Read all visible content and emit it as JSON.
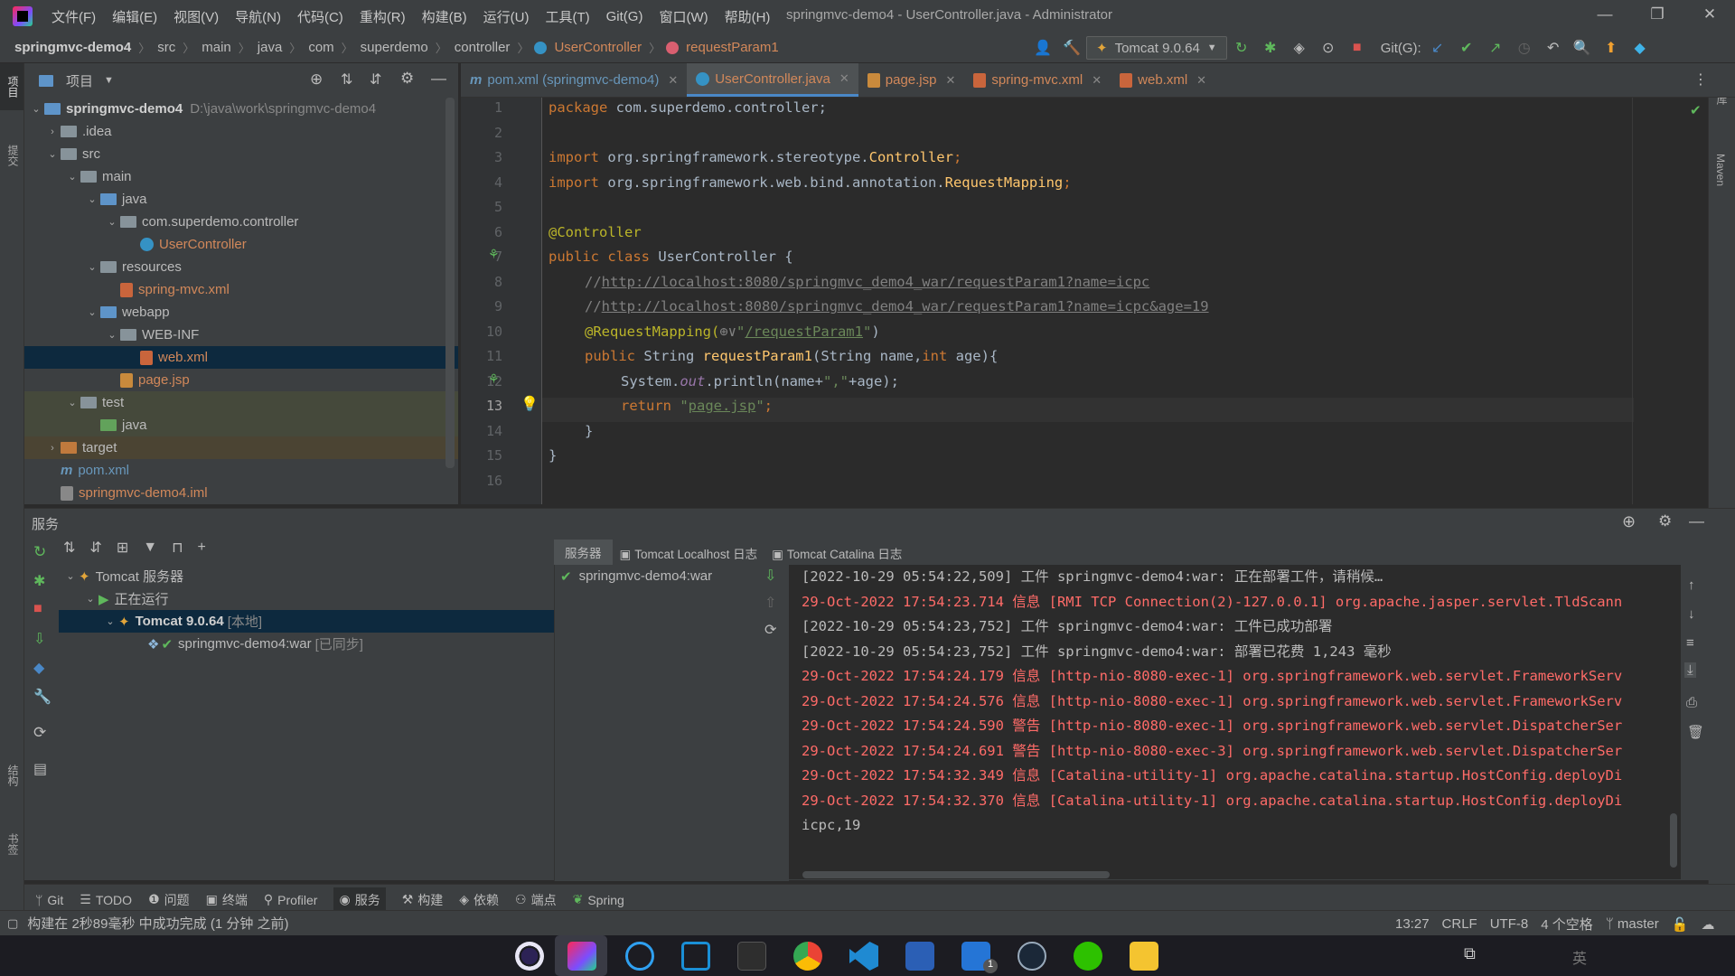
{
  "window": {
    "title": "springmvc-demo4 - UserController.java - Administrator",
    "menu": [
      "文件(F)",
      "编辑(E)",
      "视图(V)",
      "导航(N)",
      "代码(C)",
      "重构(R)",
      "构建(B)",
      "运行(U)",
      "工具(T)",
      "Git(G)",
      "窗口(W)",
      "帮助(H)"
    ]
  },
  "breadcrumb": [
    "springmvc-demo4",
    "src",
    "main",
    "java",
    "com",
    "superdemo",
    "controller",
    "UserController",
    "requestParam1"
  ],
  "toolbar": {
    "run_config": "Tomcat 9.0.64",
    "git_label": "Git(G):"
  },
  "left_strip": {
    "project_label": "项目",
    "commit_label": "提交",
    "structure_label": "结构",
    "bookmarks_label": "书签"
  },
  "right_strip": {
    "database_label": "数据库",
    "maven_label": "Maven",
    "notifications_label": "通知"
  },
  "project": {
    "header": "项目",
    "tree": [
      {
        "label": "springmvc-demo4",
        "extra": "D:\\java\\work\\springmvc-demo4"
      },
      {
        "label": ".idea"
      },
      {
        "label": "src"
      },
      {
        "label": "main"
      },
      {
        "label": "java"
      },
      {
        "label": "com.superdemo.controller"
      },
      {
        "label": "UserController"
      },
      {
        "label": "resources"
      },
      {
        "label": "spring-mvc.xml"
      },
      {
        "label": "webapp"
      },
      {
        "label": "WEB-INF"
      },
      {
        "label": "web.xml"
      },
      {
        "label": "page.jsp"
      },
      {
        "label": "test"
      },
      {
        "label": "java"
      },
      {
        "label": "target"
      },
      {
        "label": "pom.xml"
      },
      {
        "label": "springmvc-demo4.iml"
      }
    ]
  },
  "tabs": [
    {
      "label": "pom.xml (springmvc-demo4)"
    },
    {
      "label": "UserController.java"
    },
    {
      "label": "page.jsp"
    },
    {
      "label": "spring-mvc.xml"
    },
    {
      "label": "web.xml"
    }
  ],
  "editor": {
    "line_numbers": [
      "1",
      "2",
      "3",
      "4",
      "5",
      "6",
      "7",
      "8",
      "9",
      "10",
      "11",
      "12",
      "13",
      "14",
      "15",
      "16"
    ],
    "current_line": "13",
    "code": {
      "l1_kw": "package",
      "l1_rest": " com.superdemo.controller;",
      "l3_kw": "import",
      "l3_rest": " org.springframework.stereotype.",
      "l3_cls": "Controller",
      "l3_end": ";",
      "l4_kw": "import",
      "l4_rest": " org.springframework.web.bind.annotation.",
      "l4_cls": "RequestMapping",
      "l4_end": ";",
      "l6_ann": "@Controller",
      "l7_kw": "public class",
      "l7_rest": " UserController {",
      "l8_cmt": "//",
      "l8_url": "http://localhost:8080/springmvc_demo4_war/requestParam1?name=icpc",
      "l9_cmt": "//",
      "l9_url": "http://localhost:8080/springmvc_demo4_war/requestParam1?name=icpc&age=19",
      "l10_ann": "@RequestMapping(",
      "l10_icon": "⊕∨",
      "l10_q1": "\"",
      "l10_str": "/requestParam1",
      "l10_q2": "\"",
      "l10_end": ")",
      "l11_kw": "public",
      "l11_a": " String ",
      "l11_fn": "requestParam1",
      "l11_b": "(String name,",
      "l11_kw2": "int",
      "l11_c": " age){",
      "l12_a": "System.",
      "l12_fld": "out",
      "l12_b": ".println(name+",
      "l12_str": "\",\"",
      "l12_c": "+age);",
      "l13_kw": "return",
      "l13_q1": " \"",
      "l13_str": "page.jsp",
      "l13_q2": "\"",
      "l13_end": ";",
      "l14": "}",
      "l15": "}"
    }
  },
  "services": {
    "title": "服务",
    "tree": {
      "root": "Tomcat 服务器",
      "running": "正在运行",
      "server": "Tomcat 9.0.64",
      "server_tag": "[本地]",
      "artifact": "springmvc-demo4:war",
      "artifact_tag": "[已同步]"
    },
    "console_tabs": [
      "服务器",
      "Tomcat Localhost 日志",
      "Tomcat Catalina 日志"
    ],
    "deployment": "springmvc-demo4:war",
    "log": [
      {
        "text": "[2022-10-29 05:54:22,509] 工件 springmvc-demo4:war: 正在部署工件，请稍候…",
        "color": "white"
      },
      {
        "text": "29-Oct-2022 17:54:23.714 信息 [RMI TCP Connection(2)-127.0.0.1] org.apache.jasper.servlet.TldScann",
        "color": "red"
      },
      {
        "text": "[2022-10-29 05:54:23,752] 工件 springmvc-demo4:war: 工件已成功部署",
        "color": "white"
      },
      {
        "text": "[2022-10-29 05:54:23,752] 工件 springmvc-demo4:war: 部署已花费 1,243 毫秒",
        "color": "white"
      },
      {
        "text": "29-Oct-2022 17:54:24.179 信息 [http-nio-8080-exec-1] org.springframework.web.servlet.FrameworkServ",
        "color": "red"
      },
      {
        "text": "29-Oct-2022 17:54:24.576 信息 [http-nio-8080-exec-1] org.springframework.web.servlet.FrameworkServ",
        "color": "red"
      },
      {
        "text": "29-Oct-2022 17:54:24.590 警告 [http-nio-8080-exec-1] org.springframework.web.servlet.DispatcherSer",
        "color": "red"
      },
      {
        "text": "29-Oct-2022 17:54:24.691 警告 [http-nio-8080-exec-3] org.springframework.web.servlet.DispatcherSer",
        "color": "red"
      },
      {
        "text": "29-Oct-2022 17:54:32.349 信息 [Catalina-utility-1] org.apache.catalina.startup.HostConfig.deployDi",
        "color": "red"
      },
      {
        "text": "29-Oct-2022 17:54:32.370 信息 [Catalina-utility-1] org.apache.catalina.startup.HostConfig.deployDi",
        "color": "red"
      },
      {
        "text": "icpc,19",
        "color": "white"
      }
    ]
  },
  "bottom_tools": [
    "Git",
    "TODO",
    "问题",
    "终端",
    "Profiler",
    "服务",
    "构建",
    "依赖",
    "端点",
    "Spring"
  ],
  "status": {
    "message": "构建在 2秒89毫秒 中成功完成 (1 分钟 之前)",
    "position": "13:27",
    "line_sep": "CRLF",
    "encoding": "UTF-8",
    "indent": "4 个空格",
    "branch": "master"
  },
  "taskbar": {
    "apps": [
      "eclipse-icon",
      "intellij-icon",
      "browser-swirl-icon",
      "window-app-icon",
      "terminal-icon",
      "chrome-icon",
      "vscode-icon",
      "word-icon",
      "todo-icon",
      "steam-icon",
      "wechat-icon",
      "explorer-icon"
    ],
    "todo_badge": "1",
    "ime": "英"
  },
  "colors": {
    "accent": "#4a88c7",
    "selection": "#0d293e",
    "log_red": "#ff6b68",
    "keyword": "#cc7832",
    "annotation": "#bbb529",
    "string": "#6a8759"
  }
}
